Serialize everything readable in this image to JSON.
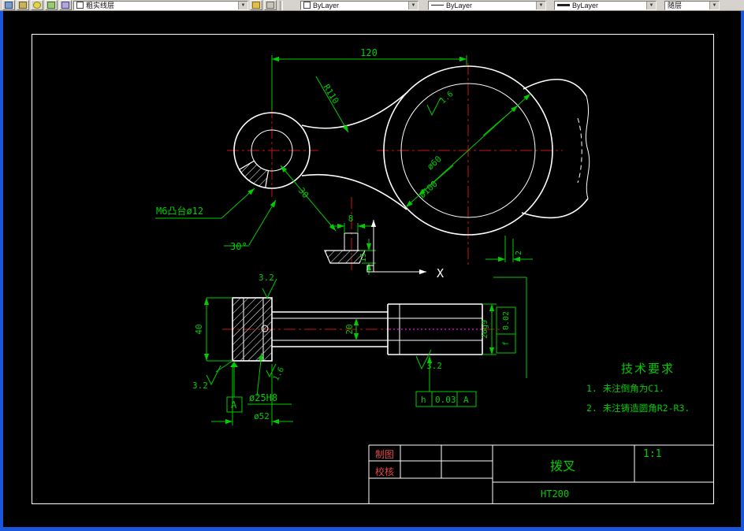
{
  "toolbar": {
    "layer": "粗实线层",
    "color": "ByLayer",
    "linetype": "ByLayer",
    "lineweight": "ByLayer",
    "plotstyle": "随层"
  },
  "top_view": {
    "dim_120": "120",
    "dim_r110": "R110",
    "dim_d60": "ø60",
    "dim_d100": "ø100",
    "rough_16": "1.6",
    "leader_m6": "M6凸台ø12",
    "dim_30deg": "30°",
    "dim_30": "30",
    "dim_8": "8",
    "dim_15": "15",
    "dim_2": "2",
    "axis_x_label": "X"
  },
  "front_view": {
    "dim_40": "40",
    "dim_20": "20",
    "dim_26": "26g9",
    "frame_f_symbol": "f",
    "frame_f_value": "0.02",
    "rough_32_top": "3.2",
    "rough_32_left": "3.2",
    "rough_32_bottom": "3.2",
    "rough_16": "1.6",
    "dim_d25": "ø25H8",
    "dim_d52": "ø52",
    "datum_label": "A",
    "frame_h_symbol": "h",
    "frame_h_value": "0.03",
    "frame_h_datum": "A"
  },
  "tech_requirements": {
    "title": "技术要求",
    "items": [
      "1. 未注倒角为C1.",
      "2. 未注铸造圆角R2-R3."
    ]
  },
  "title_block": {
    "maker_label": "制图",
    "checker_label": "校核",
    "part_name": "拨叉",
    "scale": "1:1",
    "material": "HT200"
  }
}
